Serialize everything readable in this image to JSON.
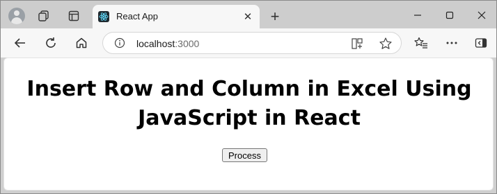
{
  "browser": {
    "tab_title": "React App",
    "tab_close": "✕",
    "new_tab": "+",
    "url_host": "localhost",
    "url_port": ":3000"
  },
  "page": {
    "heading_line1": "Insert Row and Column in Excel Using",
    "heading_line2": "JavaScript in React",
    "button_label": "Process"
  },
  "icons": {
    "avatar": "profile-icon",
    "workspaces": "workspaces-icon",
    "tab_actions": "tab-actions-icon",
    "favicon": "react-icon",
    "back": "back-arrow-icon",
    "refresh": "refresh-icon",
    "home": "home-icon",
    "info": "info-icon",
    "split": "split-screen-icon",
    "favorite": "star-icon",
    "favorites": "favorites-icon",
    "more": "more-icon",
    "sidebar": "sidebar-icon"
  },
  "colors": {
    "tabstrip": "#cdcdcd",
    "toolbar": "#f7f7f7",
    "content": "#ffffff"
  }
}
